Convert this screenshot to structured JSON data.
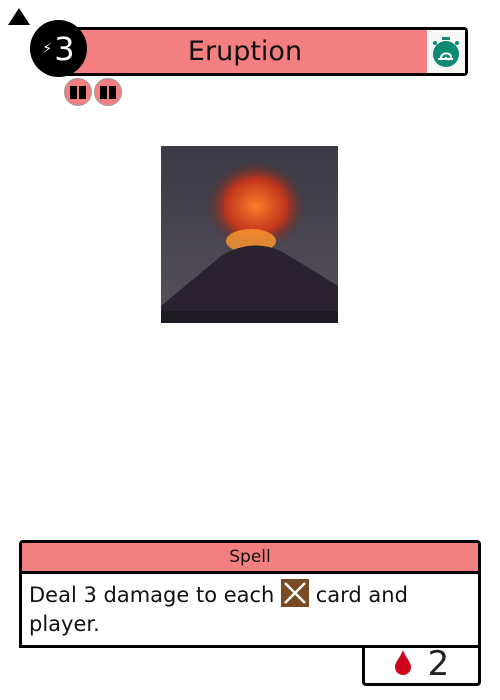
{
  "card": {
    "name": "Eruption",
    "cost": "3",
    "type": "Spell",
    "description_before": "Deal 3 damage to each",
    "description_after": "card and player.",
    "stat_value": "2",
    "icons": {
      "cost": "lightning-icon",
      "speed": "snail-stopwatch-icon",
      "badges": [
        "spellbook-icon",
        "spellbook-icon"
      ],
      "keyword": "crossed-swords-icon",
      "stat": "blood-drop-icon",
      "collapse": "triangle-up-icon"
    },
    "colors": {
      "accent": "#f47f81",
      "speed": "#0e8a74",
      "keyword": "#7a4a22",
      "blood": "#d0021b"
    }
  }
}
